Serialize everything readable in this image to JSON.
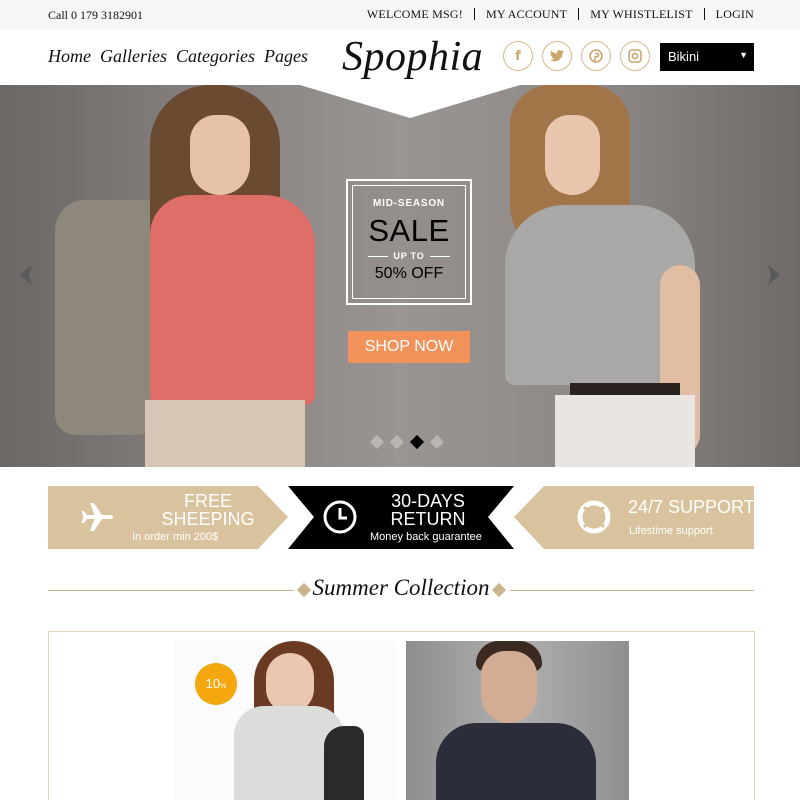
{
  "topbar": {
    "phone": "Call 0 179 3182901",
    "links": [
      "WELCOME MSG!",
      "MY ACCOUNT",
      "MY WHISTLELIST",
      "LOGIN"
    ]
  },
  "header": {
    "nav": [
      "Home",
      "Galleries",
      "Categories",
      "Pages"
    ],
    "logo": "Spophia",
    "socials": [
      "facebook-icon",
      "twitter-icon",
      "pinterest-icon",
      "instagram-icon"
    ],
    "category_select": "Bikini"
  },
  "hero": {
    "eyebrow": "MID-SEASON",
    "headline": "SALE",
    "upto": "UP TO",
    "discount": "50% OFF",
    "cta": "SHOP NOW",
    "slides_total": 4,
    "active_slide": 3
  },
  "features": [
    {
      "icon": "airplane-icon",
      "title": "FREE SHEEPING",
      "subtitle": "In order min 200$"
    },
    {
      "icon": "clock-icon",
      "title": "30-DAYS RETURN",
      "subtitle": "Money back guarantee"
    },
    {
      "icon": "lifebuoy-icon",
      "title": "24/7 SUPPORT",
      "subtitle": "Lifestime support"
    }
  ],
  "section": {
    "title": "Summer Collection"
  },
  "products": [
    {
      "badge": "10",
      "badge_unit": "%"
    },
    {}
  ],
  "colors": {
    "accent": "#d9c39e",
    "cta": "#f0925a",
    "badge": "#f4a70e",
    "dark": "#000000"
  }
}
